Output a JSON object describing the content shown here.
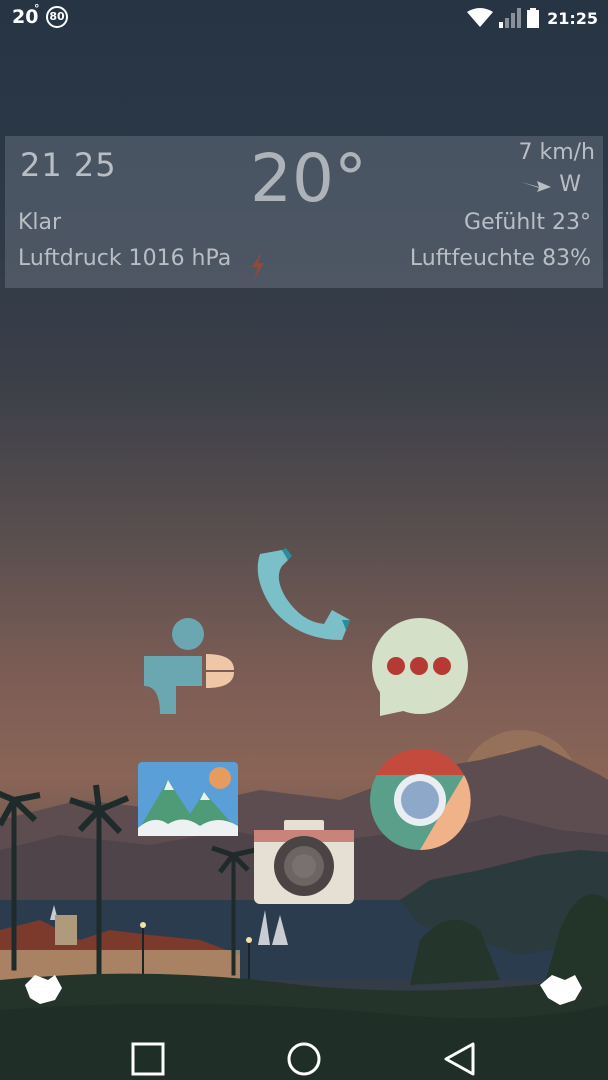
{
  "status_bar": {
    "temperature": "20",
    "degree_mark": "°",
    "badge": "80",
    "time": "21:25",
    "icons": [
      "wifi-icon",
      "signal-icon",
      "battery-icon"
    ]
  },
  "weather_widget": {
    "clock": "21  25",
    "temperature": "20°",
    "wind_speed": "7 km/h",
    "wind_direction": "W",
    "condition": "Klar",
    "feels_like": "Gefühlt 23°",
    "pressure": "Luftdruck 1016 hPa",
    "humidity": "Luftfeuchte 83%"
  },
  "apps": [
    {
      "icon": "phone-icon"
    },
    {
      "icon": "tunein-icon"
    },
    {
      "icon": "messaging-icon"
    },
    {
      "icon": "gallery-icon"
    },
    {
      "icon": "chrome-icon"
    },
    {
      "icon": "camera-icon"
    }
  ],
  "navigation": {
    "buttons": [
      "recents-button",
      "home-button",
      "back-button"
    ]
  }
}
